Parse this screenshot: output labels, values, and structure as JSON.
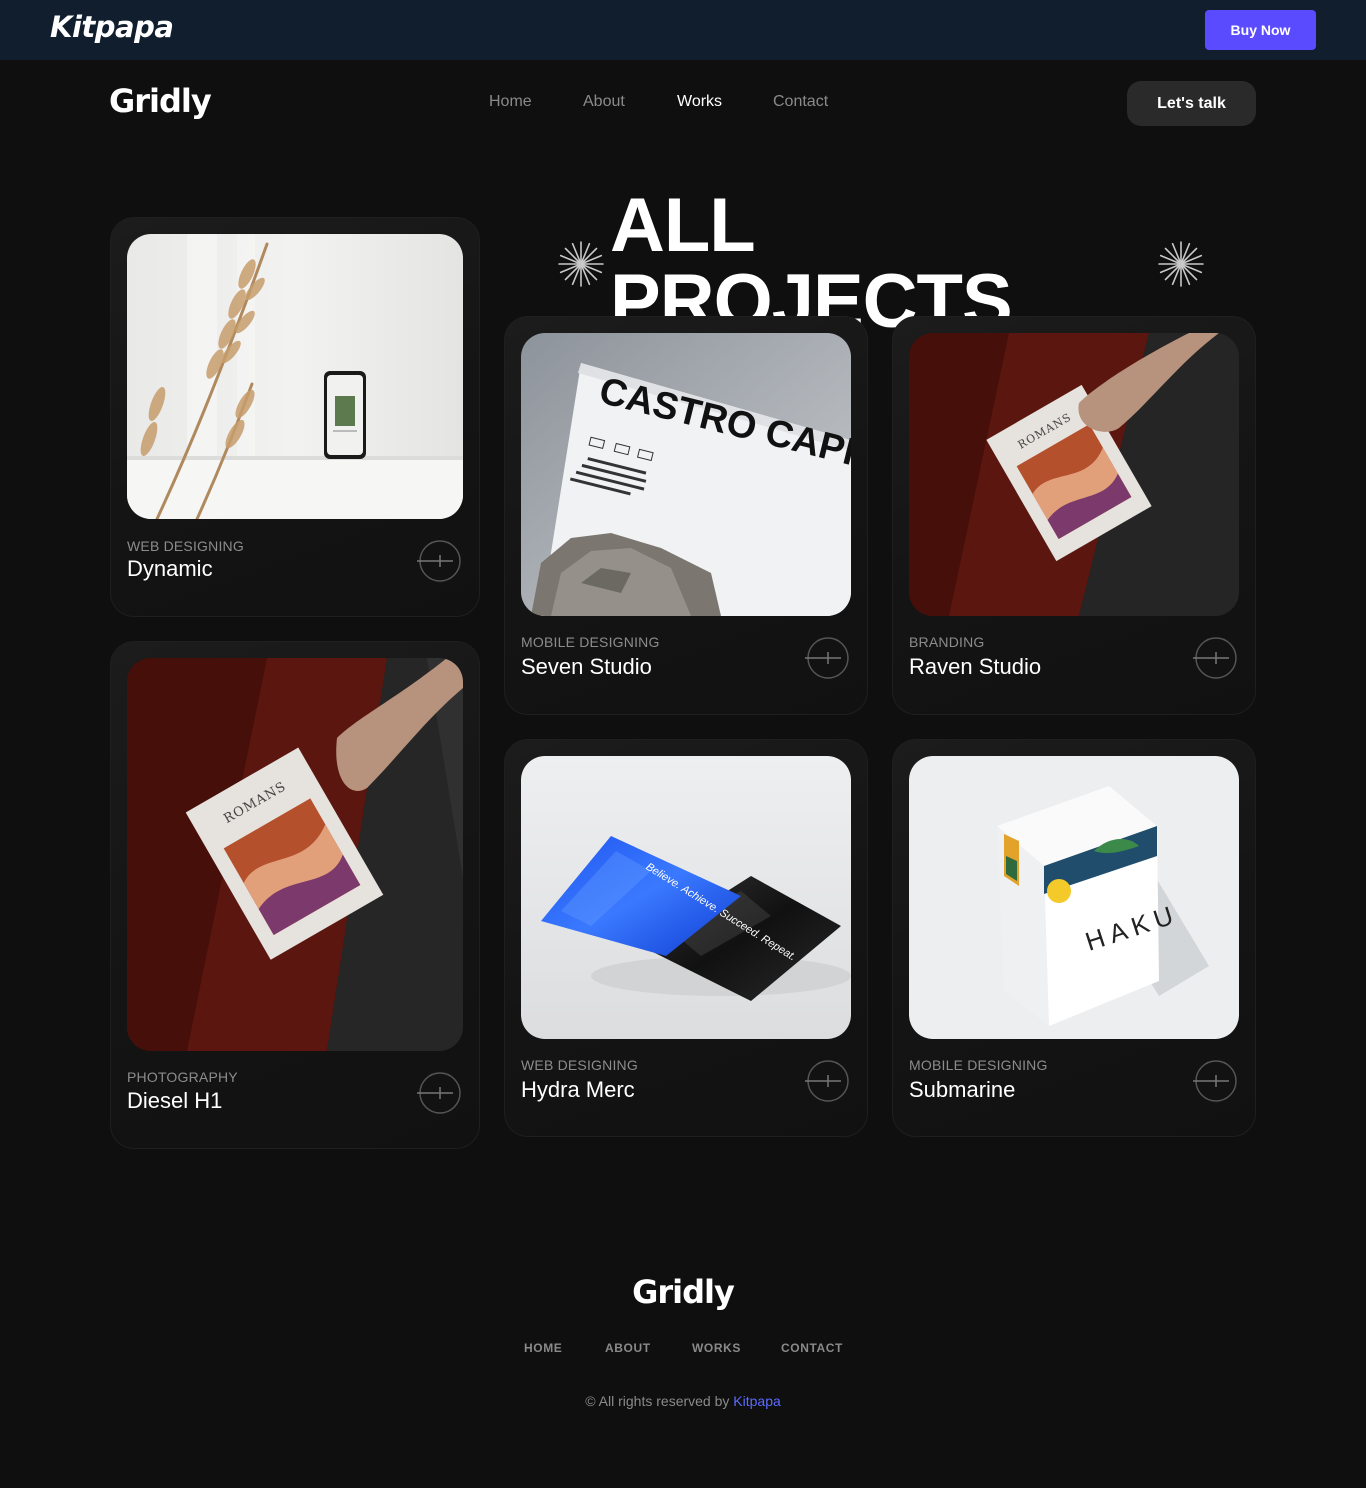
{
  "topbar": {
    "brand": "Kitpapa",
    "buy_label": "Buy Now",
    "buy_color": "#5b4bff"
  },
  "header": {
    "logo": "Gridly",
    "nav": [
      {
        "label": "Home",
        "active": false
      },
      {
        "label": "About",
        "active": false
      },
      {
        "label": "Works",
        "active": true
      },
      {
        "label": "Contact",
        "active": false
      }
    ],
    "cta_label": "Let's talk"
  },
  "main": {
    "title": "ALL PROJECTS",
    "projects": [
      {
        "category": "WEB DESIGNING",
        "name": "Dynamic",
        "image": "phone-mockup-with-dried-grass"
      },
      {
        "category": "PHOTOGRAPHY",
        "name": "Diesel H1",
        "image": "hand-holding-romans-booklet"
      },
      {
        "category": "MOBILE DESIGNING",
        "name": "Seven Studio",
        "image": "castro-capital-letterhead",
        "image_text": "CASTRO CAPIT"
      },
      {
        "category": "BRANDING",
        "name": "Raven Studio",
        "image": "hand-holding-romans-booklet"
      },
      {
        "category": "WEB DESIGNING",
        "name": "Hydra Merc",
        "image": "blue-and-black-pouches",
        "image_text": "Believe. Achieve. Succeed. Repeat."
      },
      {
        "category": "MOBILE DESIGNING",
        "name": "Submarine",
        "image": "haku-box-packaging",
        "image_text": "HAKU"
      }
    ]
  },
  "footer": {
    "logo": "Gridly",
    "nav": [
      "HOME",
      "ABOUT",
      "WORKS",
      "CONTACT"
    ],
    "copyright_prefix": "© All rights reserved by",
    "copyright_link": "Kitpapa",
    "link_color": "#5b6bff"
  }
}
